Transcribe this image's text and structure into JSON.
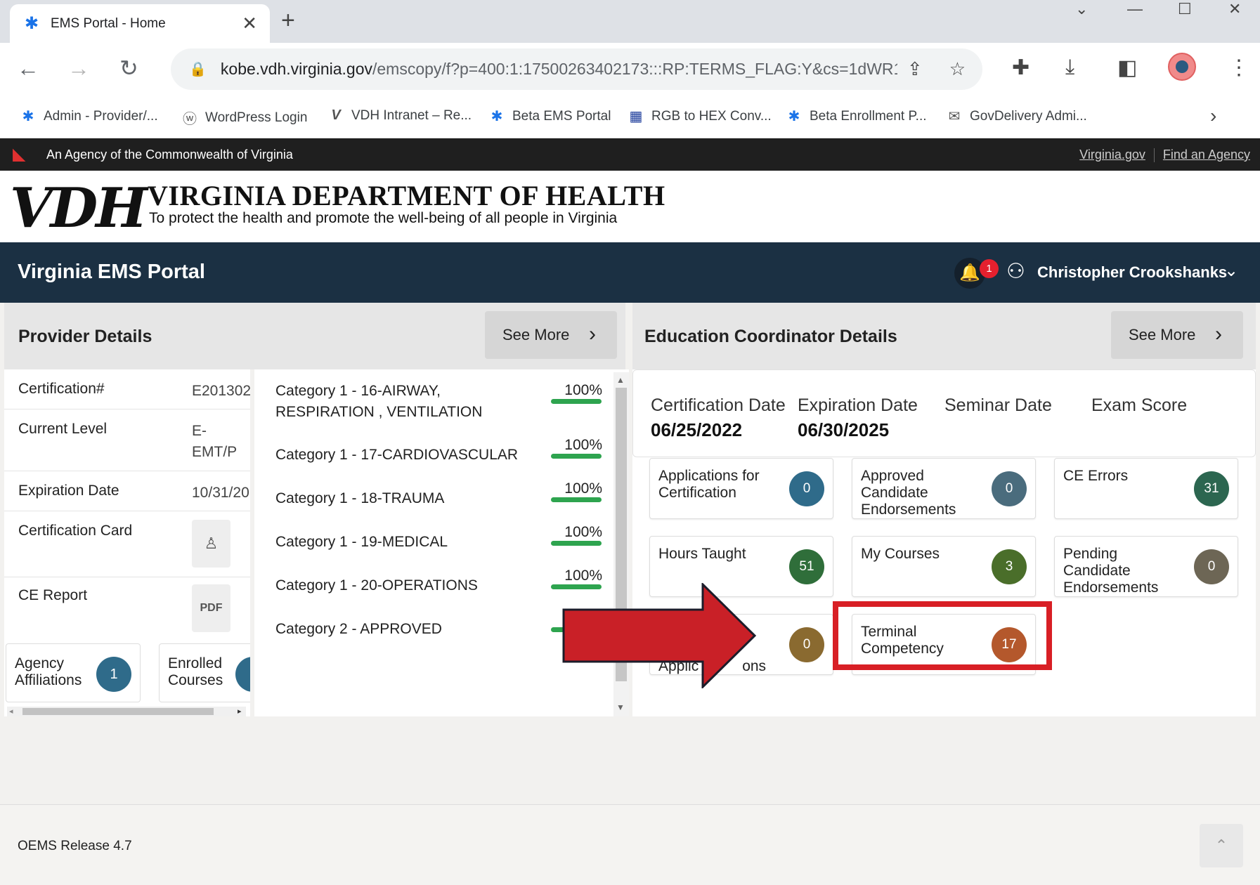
{
  "browser": {
    "tab_title": "EMS Portal - Home",
    "url_host": "kobe.vdh.virginia.gov",
    "url_path": "/emscopy/f?p=400:1:17500263402173:::RP:TERMS_FLAG:Y&cs=1dWR1...",
    "bookmarks": [
      {
        "label": "Admin - Provider/...",
        "icon": "star-of-life-icon"
      },
      {
        "label": "WordPress Login",
        "icon": "wordpress-icon"
      },
      {
        "label": "VDH Intranet – Re...",
        "icon": "vdh-icon"
      },
      {
        "label": "Beta EMS Portal",
        "icon": "star-of-life-icon"
      },
      {
        "label": "RGB to HEX Conv...",
        "icon": "tools-icon"
      },
      {
        "label": "Beta Enrollment P...",
        "icon": "star-of-life-icon"
      },
      {
        "label": "GovDelivery Admi...",
        "icon": "govdelivery-icon"
      }
    ]
  },
  "agency_bar": {
    "text": "An Agency of the Commonwealth of Virginia",
    "link1": "Virginia.gov",
    "link2": "Find an Agency"
  },
  "banner": {
    "logo": "VDH",
    "title": "VIRGINIA DEPARTMENT OF HEALTH",
    "subtitle": "To protect the health and promote the well-being of all people in Virginia"
  },
  "portal": {
    "title": "Virginia EMS Portal",
    "notification_count": "1",
    "user_name": "Christopher Crookshanks"
  },
  "provider": {
    "title": "Provider Details",
    "see_more": "See More",
    "rows": [
      {
        "label": "Certification#",
        "value": "E201302"
      },
      {
        "label": "Current Level",
        "value": "E-",
        "value2": "EMT/P"
      },
      {
        "label": "Expiration Date",
        "value": "10/31/20"
      },
      {
        "label": "Certification Card"
      },
      {
        "label": "CE Report"
      }
    ],
    "agency_label1": "Agency",
    "agency_label2": "Affiliations",
    "agency_count": "1",
    "enrolled_label1": "Enrolled",
    "enrolled_label2": "Courses"
  },
  "categories": [
    {
      "line1": "Category 1 - 16-AIRWAY,",
      "line2": "RESPIRATION , VENTILATION",
      "pct": "100%",
      "progress": 1.0
    },
    {
      "line1": "Category 1 - 17-CARDIOVASCULAR",
      "pct": "100%",
      "progress": 1.0
    },
    {
      "line1": "Category 1 - 18-TRAUMA",
      "pct": "100%",
      "progress": 1.0
    },
    {
      "line1": "Category 1 - 19-MEDICAL",
      "pct": "100%",
      "progress": 1.0
    },
    {
      "line1": "Category 1 - 20-OPERATIONS",
      "pct": "100%",
      "progress": 1.0
    },
    {
      "line1": "Category 2 - APPROVED"
    }
  ],
  "education": {
    "title": "Education Coordinator Details",
    "see_more": "See More",
    "headers": [
      "Certification Date",
      "Expiration Date",
      "Seminar Date",
      "Exam Score"
    ],
    "cert_date": "06/25/2022",
    "exp_date": "06/30/2025",
    "stats": [
      {
        "label1": "Applications for",
        "label2": "Certification",
        "value": "0",
        "color": "#2f6b8a"
      },
      {
        "label1": "Approved",
        "label2": "Candidate",
        "label3": "Endorsements",
        "value": "0",
        "color": "#4a6c7d"
      },
      {
        "label1": "CE Errors",
        "value": "31",
        "color": "#2c6650"
      },
      {
        "label1": "Hours Taught",
        "value": "51",
        "color": "#2f6e3a"
      },
      {
        "label1": "My Courses",
        "value": "3",
        "color": "#4a6e2a"
      },
      {
        "label1": "Pending",
        "label2": "Candidate",
        "label3": "Endorsements",
        "value": "0",
        "color": "#6d6655"
      },
      {
        "label1": "Applic",
        "label2": "ons",
        "value": "0",
        "color": "#8a6a30"
      },
      {
        "label1": "Terminal",
        "label2": "Competency",
        "value": "17",
        "color": "#b4582c"
      }
    ]
  },
  "footer": {
    "release": "OEMS Release 4.7"
  },
  "colors": {
    "highlight": "#d81f25",
    "arrow": "#c92027",
    "header_bg": "#1b3043"
  }
}
